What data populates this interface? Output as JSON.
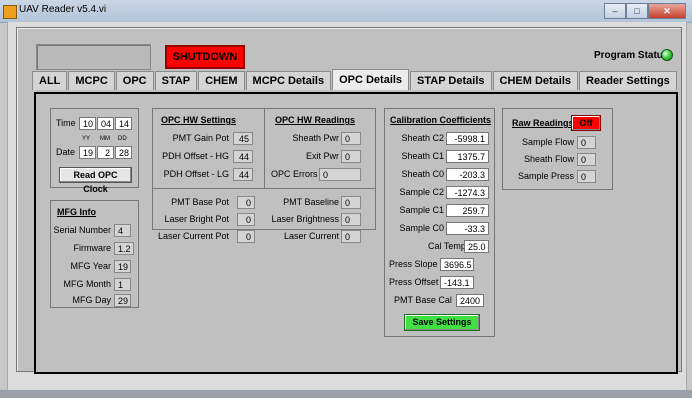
{
  "window": {
    "title": "UAV Reader v5.4.vi",
    "minimize": "–",
    "maximize": "□",
    "close": "✕"
  },
  "header": {
    "shutdown_label": "SHUTDOWN",
    "program_status_label": "Program Status",
    "status_color": "#34c034"
  },
  "tabs": [
    {
      "label": "ALL"
    },
    {
      "label": "MCPC"
    },
    {
      "label": "OPC"
    },
    {
      "label": "STAP"
    },
    {
      "label": "CHEM"
    },
    {
      "label": "MCPC Details"
    },
    {
      "label": "OPC Details",
      "active": true
    },
    {
      "label": "STAP Details"
    },
    {
      "label": "CHEM Details"
    },
    {
      "label": "Reader Settings"
    }
  ],
  "clock": {
    "time_label": "Time",
    "time": [
      "10",
      "04",
      "14"
    ],
    "date_label": "Date",
    "date": [
      "19",
      "2",
      "28"
    ],
    "date_heads": [
      "YY",
      "MM",
      "DD"
    ],
    "read_button": "Read OPC Clock"
  },
  "mfg": {
    "title": "MFG Info",
    "rows": [
      {
        "label": "Serial Number",
        "value": "4"
      },
      {
        "label": "Firmware",
        "value": "1.2"
      },
      {
        "label": "MFG Year",
        "value": "19"
      },
      {
        "label": "MFG Month",
        "value": "1"
      },
      {
        "label": "MFG Day",
        "value": "29"
      }
    ]
  },
  "hw_settings": {
    "title": "OPC HW Settings",
    "rows": [
      {
        "label": "PMT Gain Pot",
        "value": "45"
      },
      {
        "label": "PDH Offset - HG",
        "value": "44"
      },
      {
        "label": "PDH Offset - LG",
        "value": "44"
      }
    ]
  },
  "hw_readings": {
    "title": "OPC HW Readings",
    "rows": [
      {
        "label": "Sheath Pwr",
        "value": "0"
      },
      {
        "label": "Exit Pwr",
        "value": "0"
      },
      {
        "label": "OPC Errors",
        "value": "0"
      }
    ]
  },
  "pots": {
    "rows": [
      {
        "label": "PMT Base Pot",
        "value": "0"
      },
      {
        "label": "Laser Bright Pot",
        "value": "0"
      },
      {
        "label": "Laser Current Pot",
        "value": "0"
      }
    ]
  },
  "pot_readings": {
    "rows": [
      {
        "label": "PMT Baseline",
        "value": "0"
      },
      {
        "label": "Laser Brightness",
        "value": "0"
      },
      {
        "label": "Laser Current",
        "value": "0"
      }
    ]
  },
  "calibration": {
    "title": "Calibration Coefficients",
    "rows": [
      {
        "label": "Sheath C2",
        "value": "-5998.1"
      },
      {
        "label": "Sheath C1",
        "value": "1375.7"
      },
      {
        "label": "Sheath C0",
        "value": "-203.3"
      },
      {
        "label": "Sample C2",
        "value": "-1274.3"
      },
      {
        "label": "Sample C1",
        "value": "259.7"
      },
      {
        "label": "Sample C0",
        "value": "-33.3"
      },
      {
        "label": "Cal Temp",
        "value": "25.0"
      },
      {
        "label": "Press Slope",
        "value": "3696.5"
      },
      {
        "label": "Press Offset",
        "value": "-143.1"
      },
      {
        "label": "PMT Base Cal",
        "value": "2400"
      }
    ],
    "save_button": "Save Settings"
  },
  "raw": {
    "title": "Raw Readings",
    "toggle": "Off",
    "rows": [
      {
        "label": "Sample Flow",
        "value": "0"
      },
      {
        "label": "Sheath Flow",
        "value": "0"
      },
      {
        "label": "Sample Press",
        "value": "0"
      }
    ]
  }
}
